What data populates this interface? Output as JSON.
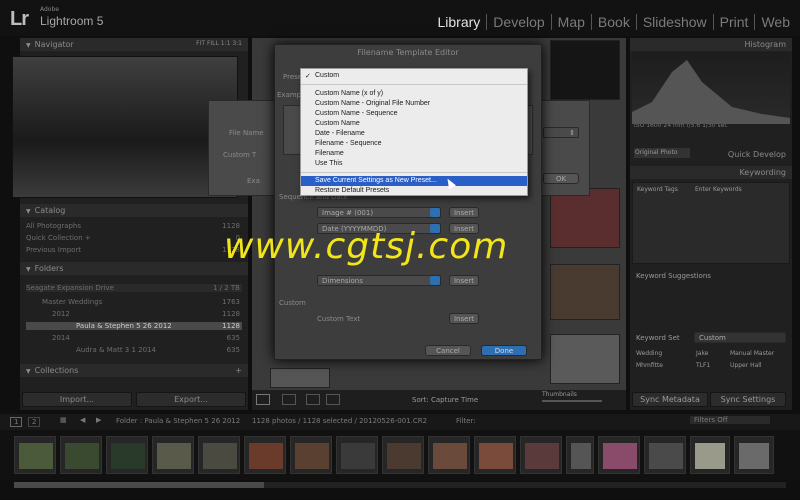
{
  "app": {
    "logo": "Lr",
    "brand_small": "Adobe",
    "brand_name": "Lightroom 5",
    "modules": [
      "Library",
      "Develop",
      "Map",
      "Book",
      "Slideshow",
      "Print",
      "Web"
    ]
  },
  "left_panel": {
    "navigator_title": "Navigator",
    "navigator_zoom": "FIT  FILL  1:1  3:1",
    "catalog_title": "Catalog",
    "catalog_items": [
      {
        "label": "All Photographs",
        "count": "1128"
      },
      {
        "label": "Quick Collection +",
        "count": "0"
      },
      {
        "label": "Previous Import",
        "count": "1128"
      }
    ],
    "folders_title": "Folders",
    "drive": {
      "label": "Seagate Expansion Drive",
      "count": "1 / 2 TB"
    },
    "folders": [
      {
        "label": "Master Weddings",
        "count": "1763"
      },
      {
        "label": "2012",
        "count": "1128"
      },
      {
        "label": "Paula & Stephen 5 26 2012",
        "count": "1128"
      },
      {
        "label": "2014",
        "count": "635"
      },
      {
        "label": "Audra & Matt 3 1 2014",
        "count": "635"
      }
    ],
    "collections_title": "Collections",
    "import_label": "Import...",
    "export_label": "Export..."
  },
  "dialog": {
    "title": "Filename Template Editor",
    "preset_label": "Preset:",
    "example_label": "Example:",
    "sequence_label": "Sequence and Date",
    "image_number": "Image # (001)",
    "date_format": "Date (YYYYMMDD)",
    "dimensions": "Dimensions",
    "custom_label": "Custom",
    "custom_text_label": "Custom Text",
    "insert_label": "Insert",
    "cancel_label": "Cancel",
    "done_label": "Done"
  },
  "back_dialog": {
    "file_name_label": "File Name",
    "custom_text_label": "Custom T",
    "example_label": "Exa",
    "ok_label": "OK"
  },
  "dropdown": {
    "checked": "Custom",
    "items": [
      "Custom Name (x of y)",
      "Custom Name - Original File Number",
      "Custom Name - Sequence",
      "Custom Name",
      "Date - Filename",
      "Filename - Sequence",
      "Filename",
      "Use This"
    ],
    "selected_item": "Save Current Settings as New Preset...",
    "last_item": "Restore Default Presets"
  },
  "watermark": "www.cgtsj.com",
  "right_panel": {
    "histogram_title": "Histogram",
    "histogram_info": "ISO 1600   24 mm   f/5.6   1/30 sec",
    "original_photo": "Original Photo",
    "quick_develop_title": "Quick Develop",
    "keywording_title": "Keywording",
    "keyword_tags_label": "Keyword Tags",
    "keyword_tags_value": "Enter Keywords",
    "keyword_suggestions": "Keyword Suggestions",
    "keyword_set_label": "Keyword Set",
    "keyword_set_value": "Custom",
    "keyword_set_items": [
      "Wedding",
      "Jake",
      "Manual Master",
      "Mhmfitte",
      "TLF1",
      "Upper Hall"
    ],
    "sync_metadata": "Sync Metadata",
    "sync_settings": "Sync Settings"
  },
  "toolbar": {
    "sort_label": "Sort:",
    "sort_value": "Capture Time",
    "thumbnails_label": "Thumbnails"
  },
  "filmstrip": {
    "page1": "1",
    "page2": "2",
    "folder_path": "Folder : Paula & Stephen 5 26 2012",
    "photo_count": "1128 photos / 1128 selected / 20120526-001.CR2",
    "filter_label": "Filter:",
    "filters_off": "Filters Off"
  },
  "colors": {
    "accent": "#2d6fb3",
    "menu_highlight": "#2a5fc8",
    "watermark": "#f2e61a"
  }
}
